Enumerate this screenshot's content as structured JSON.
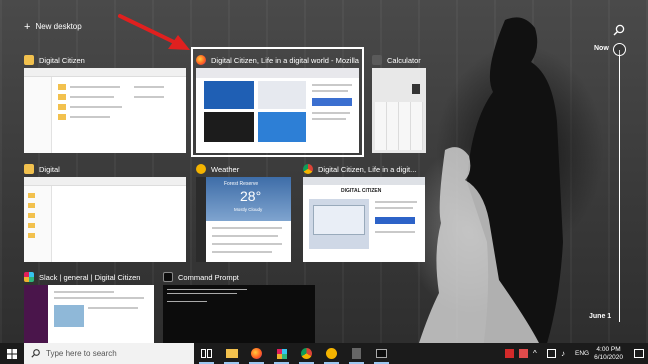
{
  "desktop": {
    "new_desktop_label": "New desktop"
  },
  "windows": [
    {
      "title": "Digital Citizen",
      "icon": "folder-icon"
    },
    {
      "title": "Digital Citizen, Life in a digital world - Mozilla...",
      "icon": "firefox-icon"
    },
    {
      "title": "Calculator",
      "icon": "calculator-icon"
    },
    {
      "title": "Digital",
      "icon": "folder-icon"
    },
    {
      "title": "Weather",
      "icon": "weather-icon"
    },
    {
      "title": "Digital Citizen, Life in a digit...",
      "icon": "chrome-icon"
    },
    {
      "title": "Slack | general | Digital Citizen",
      "icon": "slack-icon"
    },
    {
      "title": "Command Prompt",
      "icon": "cmd-icon"
    }
  ],
  "weather_preview": {
    "city": "Forest Reserve",
    "temperature": "28°",
    "condition": "Mostly Cloudy"
  },
  "chrome_preview": {
    "site_title": "DIGITAL CITIZEN"
  },
  "timeline": {
    "now_label": "Now",
    "date_label": "June 1"
  },
  "taskbar": {
    "search_placeholder": "Type here to search",
    "language": "ENG",
    "time": "4:00 PM",
    "date": "6/10/2020"
  },
  "colors": {
    "taskbar": "#1b1b1b",
    "selection_border": "#ffffff",
    "arrow": "#e0201f",
    "accent": "#0078d7"
  }
}
